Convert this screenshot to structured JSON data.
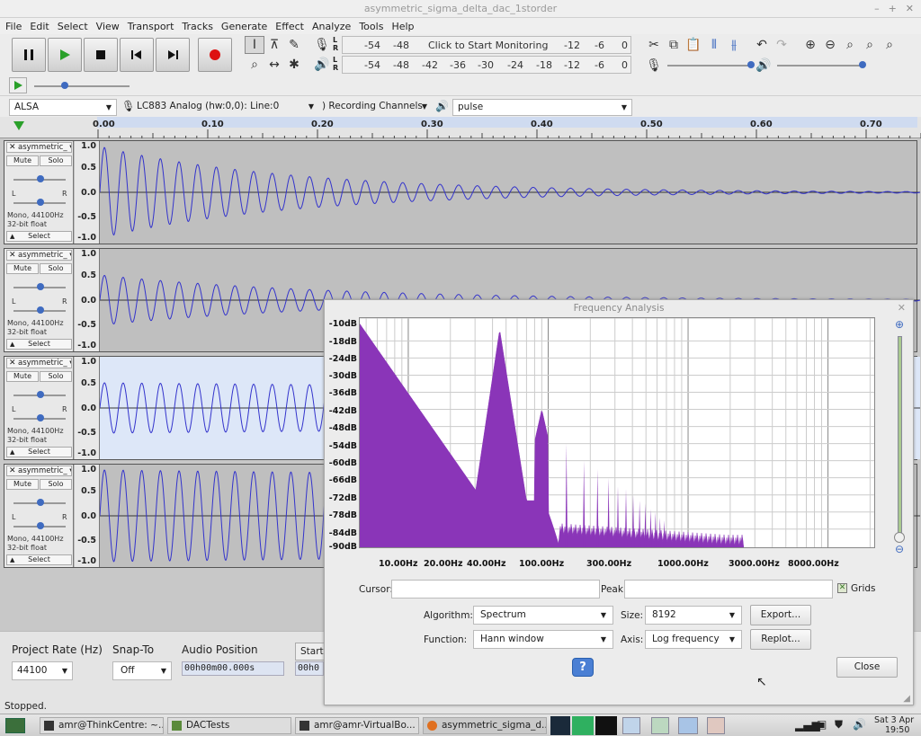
{
  "window": {
    "title": "asymmetric_sigma_delta_dac_1storder"
  },
  "menu": [
    "File",
    "Edit",
    "Select",
    "View",
    "Transport",
    "Tracks",
    "Generate",
    "Effect",
    "Analyze",
    "Tools",
    "Help"
  ],
  "meters": {
    "record_scale": [
      "-54",
      "-48",
      "-12",
      "-6",
      "0"
    ],
    "record_prompt": "Click to Start Monitoring",
    "play_scale": [
      "-54",
      "-48",
      "-42",
      "-36",
      "-30",
      "-24",
      "-18",
      "-12",
      "-6",
      "0"
    ]
  },
  "devices": {
    "host": "ALSA",
    "recording_device": "LC883 Analog (hw:0,0): Line:0",
    "channels": ") Recording Channels",
    "playback_device": "pulse"
  },
  "timeline": {
    "labels": [
      "0.00",
      "0.10",
      "0.20",
      "0.30",
      "0.40",
      "0.50",
      "0.60",
      "0.70"
    ]
  },
  "tracks": [
    {
      "name": "asymmetric_",
      "mute": "Mute",
      "solo": "Solo",
      "info1": "Mono, 44100Hz",
      "info2": "32-bit float",
      "select": "Select",
      "scale": [
        "1.0",
        "0.5",
        "0.0",
        "-0.5",
        "-1.0"
      ]
    },
    {
      "name": "asymmetric_",
      "mute": "Mute",
      "solo": "Solo",
      "info1": "Mono, 44100Hz",
      "info2": "32-bit float",
      "select": "Select",
      "scale": [
        "1.0",
        "0.5",
        "0.0",
        "-0.5",
        "-1.0"
      ]
    },
    {
      "name": "asymmetric_",
      "mute": "Mute",
      "solo": "Solo",
      "info1": "Mono, 44100Hz",
      "info2": "32-bit float",
      "select": "Select",
      "scale": [
        "1.0",
        "0.5",
        "0.0",
        "-0.5",
        "-1.0"
      ]
    },
    {
      "name": "asymmetric_",
      "mute": "Mute",
      "solo": "Solo",
      "info1": "Mono, 44100Hz",
      "info2": "32-bit float",
      "select": "Select",
      "scale": [
        "1.0",
        "0.5",
        "0.0",
        "-0.5",
        "-1.0"
      ]
    }
  ],
  "bottom": {
    "rate_label": "Project Rate (Hz)",
    "rate_value": "44100",
    "snap_label": "Snap-To",
    "snap_value": "Off",
    "audio_pos_label": "Audio Position",
    "audio_pos_value": "00h00m00.000s",
    "start_label": "Start",
    "start_value": "00h0"
  },
  "status": "Stopped.",
  "dialog": {
    "title": "Frequency Analysis",
    "y_labels": [
      "-10dB",
      "-18dB",
      "-24dB",
      "-30dB",
      "-36dB",
      "-42dB",
      "-48dB",
      "-54dB",
      "-60dB",
      "-66dB",
      "-72dB",
      "-78dB",
      "-84dB",
      "-90dB"
    ],
    "x_labels": [
      "10.00Hz",
      "20.00Hz",
      "40.00Hz",
      "100.00Hz",
      "300.00Hz",
      "1000.00Hz",
      "3000.00Hz",
      "8000.00Hz"
    ],
    "cursor_label": "Cursor:",
    "peak_label": "Peak:",
    "grids_label": "Grids",
    "algorithm_label": "Algorithm:",
    "algorithm_value": "Spectrum",
    "size_label": "Size:",
    "size_value": "8192",
    "function_label": "Function:",
    "function_value": "Hann window",
    "axis_label": "Axis:",
    "axis_value": "Log frequency",
    "export_label": "Export...",
    "replot_label": "Replot...",
    "help_label": "?",
    "close_label": "Close"
  },
  "taskbar": {
    "items": [
      "amr@ThinkCentre: ~...",
      "DACTests",
      "amr@amr-VirtualBo...",
      "asymmetric_sigma_d..."
    ],
    "date": "Sat 3 Apr",
    "time": "19:50"
  },
  "colors": {
    "spectrum": "#8a35b8",
    "waveform": "#3333cc",
    "accent": "#3f6bc0"
  }
}
